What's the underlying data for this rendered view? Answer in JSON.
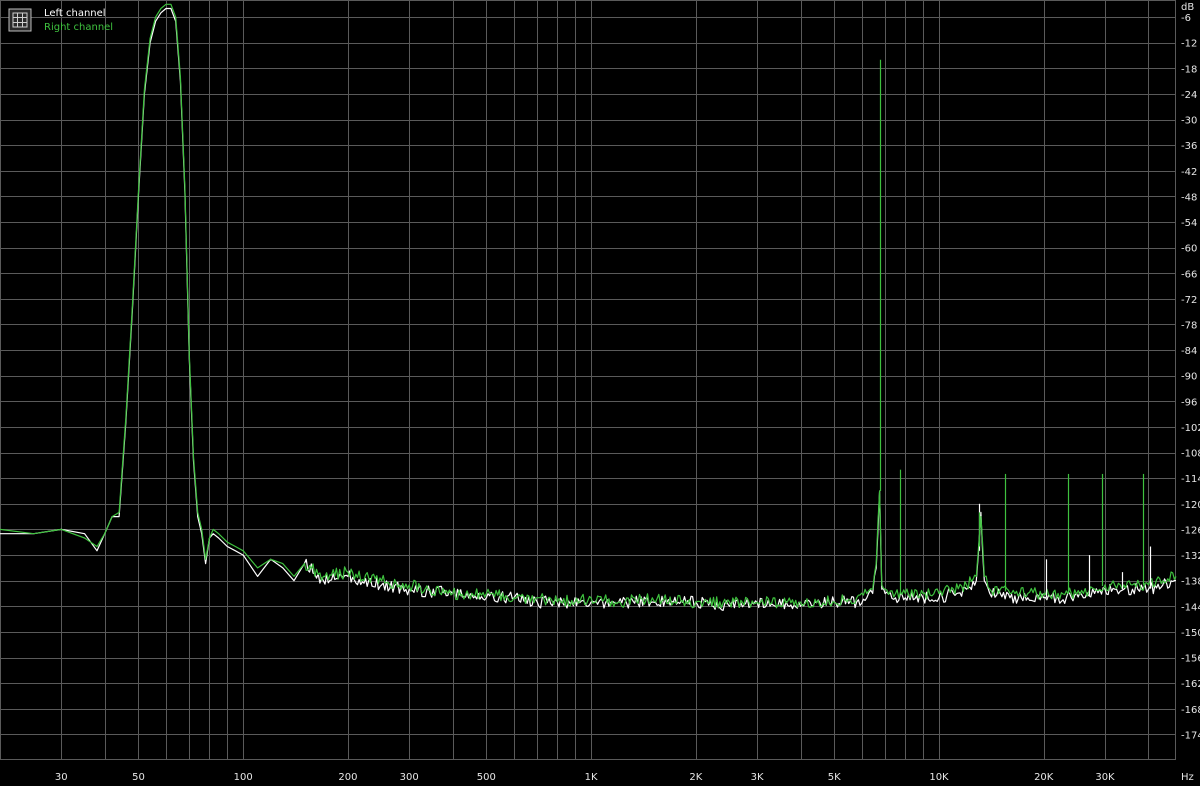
{
  "chart_data": {
    "type": "line",
    "title": "",
    "xlabel": "",
    "ylabel": "",
    "x_unit": "Hz",
    "y_unit": "dB",
    "xscale": "log",
    "xlim": [
      20,
      48000
    ],
    "ylim": [
      -180,
      -2
    ],
    "grid": true,
    "legend_position": "top-left",
    "background": "#000000",
    "grid_color": "#5a5a5a",
    "x_ticks": [
      {
        "value": 30,
        "label": "30"
      },
      {
        "value": 50,
        "label": "50"
      },
      {
        "value": 100,
        "label": "100"
      },
      {
        "value": 200,
        "label": "200"
      },
      {
        "value": 300,
        "label": "300"
      },
      {
        "value": 500,
        "label": "500"
      },
      {
        "value": 1000,
        "label": "1K"
      },
      {
        "value": 2000,
        "label": "2K"
      },
      {
        "value": 3000,
        "label": "3K"
      },
      {
        "value": 5000,
        "label": "5K"
      },
      {
        "value": 10000,
        "label": "10K"
      },
      {
        "value": 20000,
        "label": "20K"
      },
      {
        "value": 30000,
        "label": "30K"
      }
    ],
    "y_ticks": [
      -6,
      -12,
      -18,
      -24,
      -30,
      -36,
      -42,
      -48,
      -54,
      -60,
      -66,
      -72,
      -78,
      -84,
      -90,
      -96,
      -102,
      -108,
      -114,
      -120,
      -126,
      -132,
      -138,
      -144,
      -150,
      -156,
      -162,
      -168,
      -174
    ],
    "series": [
      {
        "name": "Left channel",
        "color": "#ffffff",
        "x": [
          20,
          25,
          30,
          35,
          38,
          40,
          42,
          44,
          46,
          48,
          50,
          52,
          54,
          56,
          58,
          60,
          62,
          64,
          66,
          68,
          70,
          72,
          74,
          76,
          78,
          80,
          82,
          85,
          90,
          95,
          100,
          110,
          120,
          130,
          140,
          150,
          170,
          200,
          250,
          300,
          400,
          500,
          600,
          700,
          800,
          1000,
          1200,
          1500,
          2000,
          2500,
          3000,
          4000,
          5000,
          5800,
          6200,
          6450,
          6600,
          6750,
          6850,
          7000,
          7500,
          8000,
          9000,
          10000,
          11000,
          12000,
          12800,
          13000,
          13200,
          13500,
          14000,
          15000,
          16000,
          18000,
          20000,
          22000,
          24000,
          26000,
          28000,
          30000,
          32000,
          34000,
          36000,
          40000,
          44000,
          48000
        ],
        "y": [
          -127,
          -127,
          -126,
          -127,
          -131,
          -127,
          -123,
          -123,
          -101,
          -75,
          -48,
          -24,
          -12,
          -7,
          -5,
          -4,
          -4,
          -7,
          -21,
          -47,
          -86,
          -110,
          -123,
          -127,
          -134,
          -128,
          -127,
          -128,
          -130,
          -131,
          -132,
          -137,
          -133,
          -135,
          -138,
          -134,
          -138,
          -137,
          -139,
          -140,
          -141,
          -142,
          -142,
          -143,
          -143,
          -143,
          -143,
          -143,
          -143,
          -144,
          -143,
          -144,
          -143,
          -143,
          -142,
          -141,
          -135,
          -117,
          -140,
          -141,
          -142,
          -142,
          -142,
          -142,
          -141,
          -140,
          -138,
          -131,
          -122,
          -138,
          -141,
          -141,
          -142,
          -142,
          -142,
          -142,
          -142,
          -142,
          -141,
          -140,
          -140,
          -140,
          -140,
          -140,
          -139,
          -138
        ]
      },
      {
        "name": "Right channel",
        "color": "#3ec13e",
        "x": [
          20,
          25,
          30,
          35,
          38,
          40,
          42,
          44,
          46,
          48,
          50,
          52,
          54,
          56,
          58,
          60,
          62,
          64,
          66,
          68,
          70,
          72,
          74,
          76,
          78,
          80,
          82,
          85,
          90,
          95,
          100,
          110,
          120,
          130,
          140,
          150,
          170,
          200,
          250,
          300,
          400,
          500,
          600,
          700,
          800,
          1000,
          1200,
          1500,
          2000,
          2500,
          3000,
          4000,
          5000,
          5800,
          6200,
          6450,
          6600,
          6750,
          6850,
          7000,
          7500,
          8000,
          9000,
          10000,
          11000,
          12000,
          12800,
          13000,
          13200,
          13500,
          14000,
          15000,
          16000,
          18000,
          20000,
          22000,
          24000,
          26000,
          28000,
          30000,
          32000,
          34000,
          36000,
          40000,
          44000,
          48000
        ],
        "y": [
          -126,
          -127,
          -126,
          -128,
          -130,
          -127,
          -123,
          -122,
          -100,
          -74,
          -47,
          -23,
          -11,
          -6,
          -4,
          -3,
          -3,
          -6,
          -20,
          -46,
          -85,
          -109,
          -122,
          -126,
          -133,
          -128,
          -126,
          -127,
          -129,
          -130,
          -131,
          -135,
          -133,
          -134,
          -137,
          -134,
          -137,
          -136,
          -138,
          -139,
          -141,
          -141,
          -142,
          -142,
          -143,
          -142,
          -143,
          -142,
          -143,
          -143,
          -143,
          -143,
          -143,
          -142,
          -141,
          -140,
          -134,
          -117,
          -139,
          -140,
          -141,
          -141,
          -141,
          -141,
          -140,
          -139,
          -137,
          -130,
          -123,
          -137,
          -140,
          -140,
          -141,
          -141,
          -141,
          -141,
          -141,
          -141,
          -140,
          -139,
          -139,
          -139,
          -139,
          -139,
          -138,
          -137
        ]
      }
    ],
    "spikes": [
      {
        "series": "Right channel",
        "x": 6750,
        "peak": -16
      },
      {
        "series": "Right channel",
        "x": 7750,
        "peak": -112
      },
      {
        "series": "Left channel",
        "x": 13000,
        "peak": -120
      },
      {
        "series": "Right channel",
        "x": 13000,
        "peak": -122
      },
      {
        "series": "Right channel",
        "x": 15500,
        "peak": -113
      },
      {
        "series": "Left channel",
        "x": 20300,
        "peak": -133
      },
      {
        "series": "Right channel",
        "x": 23500,
        "peak": -113
      },
      {
        "series": "Left channel",
        "x": 27000,
        "peak": -132
      },
      {
        "series": "Right channel",
        "x": 29500,
        "peak": -113
      },
      {
        "series": "Left channel",
        "x": 33500,
        "peak": -136
      },
      {
        "series": "Right channel",
        "x": 38500,
        "peak": -113
      },
      {
        "series": "Left channel",
        "x": 40500,
        "peak": -130
      }
    ]
  }
}
